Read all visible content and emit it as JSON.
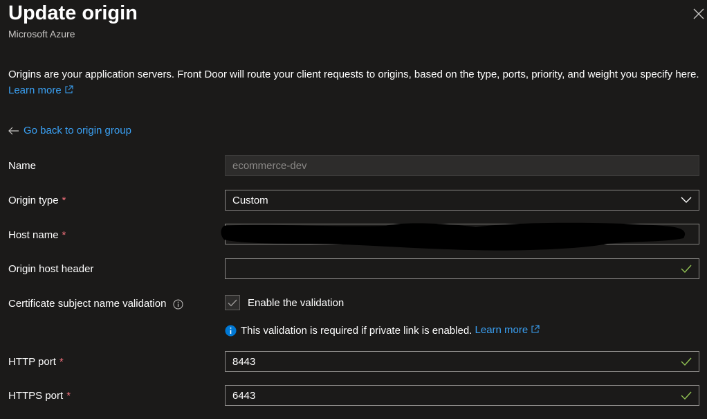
{
  "header": {
    "title": "Update origin",
    "subtitle": "Microsoft Azure"
  },
  "description": {
    "text": "Origins are your application servers. Front Door will route your client requests to origins, based on the type, ports, priority, and weight you specify here.",
    "link": "Learn more"
  },
  "back_link": "Go back to origin group",
  "form": {
    "name": {
      "label": "Name",
      "value": "ecommerce-dev"
    },
    "origin_type": {
      "label": "Origin type",
      "value": "Custom"
    },
    "host_name": {
      "label": "Host name"
    },
    "origin_host_header": {
      "label": "Origin host header",
      "value": ""
    },
    "cert_validation": {
      "label": "Certificate subject name validation",
      "checkbox_label": "Enable the validation",
      "checked": true
    },
    "validation_info": {
      "text": "This validation is required if private link is enabled.",
      "link": "Learn more"
    },
    "http_port": {
      "label": "HTTP port",
      "value": "8443"
    },
    "https_port": {
      "label": "HTTPS port",
      "value": "6443"
    },
    "required_mark": "*"
  },
  "icons": {
    "close": "close-icon",
    "external_link": "external-link-icon",
    "back_arrow": "arrow-left-icon",
    "info_outline": "info-icon",
    "info_filled": "info-filled-icon",
    "check": "checkmark-icon",
    "chevron": "chevron-down-icon"
  },
  "colors": {
    "background": "#1b1a19",
    "link": "#3aa0f3",
    "required": "#f1707b",
    "valid_check": "#92c353",
    "info_blue": "#0078d4"
  }
}
